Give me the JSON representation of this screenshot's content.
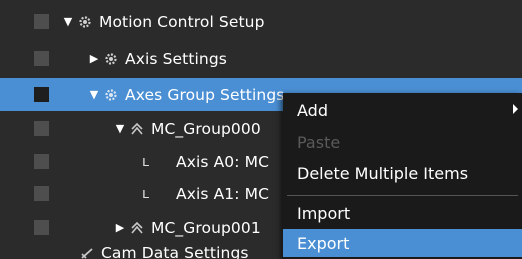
{
  "tree": {
    "rows": [
      {
        "label": "Motion Control Setup",
        "icon": "gear-icon",
        "expander": "expanded"
      },
      {
        "label": "Axis Settings",
        "icon": "gear-icon",
        "expander": "collapsed"
      },
      {
        "label": "Axes Group Settings",
        "icon": "gear-icon",
        "expander": "expanded",
        "selected": true
      },
      {
        "label": "MC_Group000",
        "icon": "axes-group-icon",
        "expander": "expanded"
      },
      {
        "label": "Axis A0: MC",
        "icon": "tree-branch-glyph"
      },
      {
        "label": "Axis A1: MC",
        "icon": "tree-branch-glyph"
      },
      {
        "label": "MC_Group001",
        "icon": "axes-group-icon",
        "expander": "collapsed"
      },
      {
        "label": "Cam Data Settings",
        "icon": "cam-icon"
      }
    ]
  },
  "context_menu": {
    "items": [
      {
        "label": "Add",
        "enabled": true,
        "submenu": true
      },
      {
        "label": "Paste",
        "enabled": false
      },
      {
        "label": "Delete Multiple Items",
        "enabled": true
      },
      {
        "label": "Import",
        "enabled": true
      },
      {
        "label": "Export",
        "enabled": true,
        "highlighted": true
      }
    ]
  },
  "colors": {
    "background": "#2b2b2b",
    "selection": "#4a8fd4",
    "menu_background": "#1a1a1a",
    "disabled_text": "#5a5a5a"
  }
}
